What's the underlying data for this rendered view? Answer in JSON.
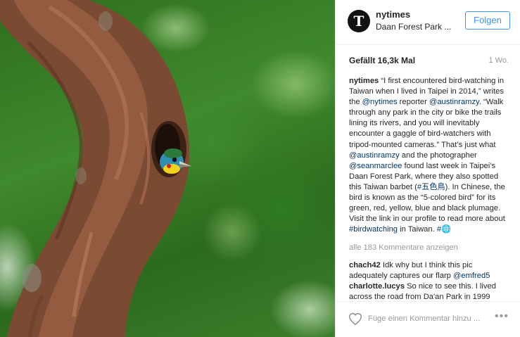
{
  "post": {
    "username": "nytimes",
    "location": "Daan Forest Park ...",
    "follow_label": "Folgen",
    "avatar_letter": "T",
    "likes": "Gefällt 16,3k Mal",
    "age": "1 Wo."
  },
  "caption": {
    "username": "nytimes",
    "t1": " “I first encountered bird-watching in Taiwan when I lived in Taipei in 2014,” writes the ",
    "m1": "@nytimes",
    "t2": " reporter ",
    "m2": "@austinramzy",
    "t3": ". “Walk through any park in the city or bike the trails lining its rivers, and you will inevitably encounter a gaggle of bird-watchers with tripod-mounted cameras.” That’s just what ",
    "m3": "@austinramzy",
    "t4": " and the photographer ",
    "m4": "@seanmarclee",
    "t5": " found last week in Taipei’s Daan Forest Park, where they also spotted this Taiwan barbet (",
    "m5": "#五色鳥",
    "t6": "). In Chinese, the bird is known as the “5-colored bird” for its green, red, yellow, blue and black plumage. Visit the link in our profile to read more about ",
    "m6": "#birdwatching",
    "t7": " in Taiwan. ",
    "m7": "#",
    "emoji": "🌐"
  },
  "comments": {
    "view_all": "alle 183 Kommentare anzeigen",
    "items": [
      {
        "username": "chach42",
        "text": " Idk why but I think this pic adequately captures our flarp ",
        "mention": "@emfred5"
      },
      {
        "username": "charlotte.lucys",
        "text": " So nice to see this. I lived across the road from Da'an Park in 1999"
      }
    ]
  },
  "footer": {
    "comment_placeholder": "Füge einen Kommentar hinzu ...",
    "more_label": "•••"
  },
  "colors": {
    "accent": "#3897f0",
    "mention": "#003569",
    "muted": "#999999"
  },
  "icons": {
    "heart": "heart-outline-icon",
    "avatar": "nytimes-logo-icon",
    "more": "more-options-icon"
  }
}
